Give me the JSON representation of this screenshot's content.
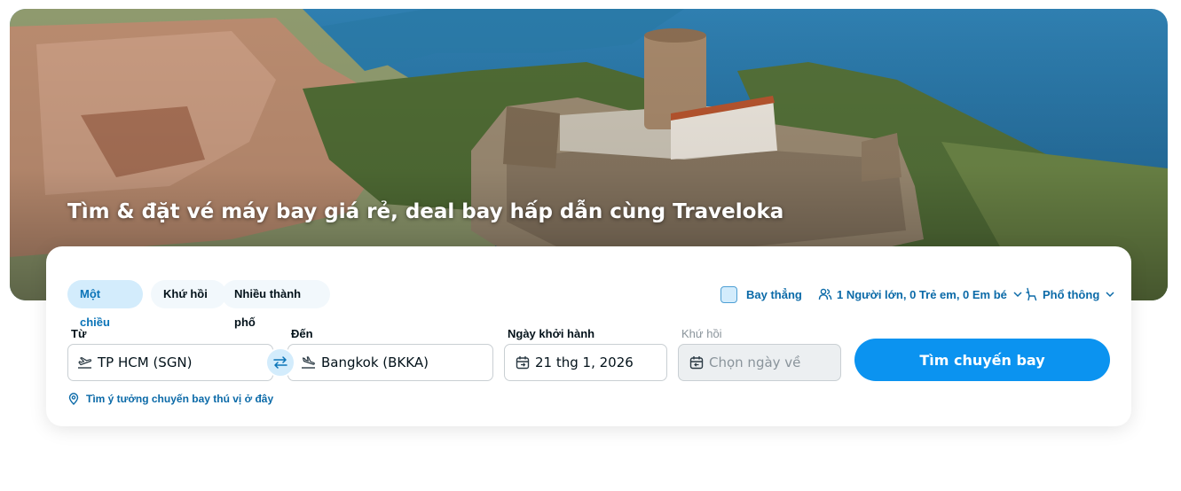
{
  "hero": {
    "title": "Tìm & đặt vé máy bay giá rẻ, deal bay hấp dẫn cùng Traveloka"
  },
  "trip_types": [
    {
      "label": "Một chiều",
      "active": true
    },
    {
      "label": "Khứ hồi",
      "active": false
    },
    {
      "label": "Nhiều thành phố",
      "active": false
    }
  ],
  "options": {
    "direct_flight_label": "Bay thẳng",
    "passengers_label": "1 Người lớn, 0 Trẻ em, 0 Em bé",
    "cabin_class_label": "Phổ thông"
  },
  "from": {
    "label": "Từ",
    "value": "TP HCM (SGN)"
  },
  "to": {
    "label": "Đến",
    "value": "Bangkok (BKKA)"
  },
  "departure": {
    "label": "Ngày khởi hành",
    "value": "21 thg 1, 2026"
  },
  "return": {
    "label": "Khứ hồi",
    "placeholder": "Chọn ngày về"
  },
  "search_button_label": "Tìm chuyến bay",
  "idea_link_label": "Tìm ý tưởng chuyến bay thú vị ở đây",
  "colors": {
    "primary": "#0b93f0",
    "link": "#0b6aa8",
    "chip_active_bg": "#d3ecfc"
  },
  "icons": [
    "takeoff-icon",
    "landing-icon",
    "swap-icon",
    "calendar-icon",
    "calendar-return-icon",
    "people-icon",
    "seat-icon",
    "chevron-down-icon",
    "map-pin-icon"
  ]
}
